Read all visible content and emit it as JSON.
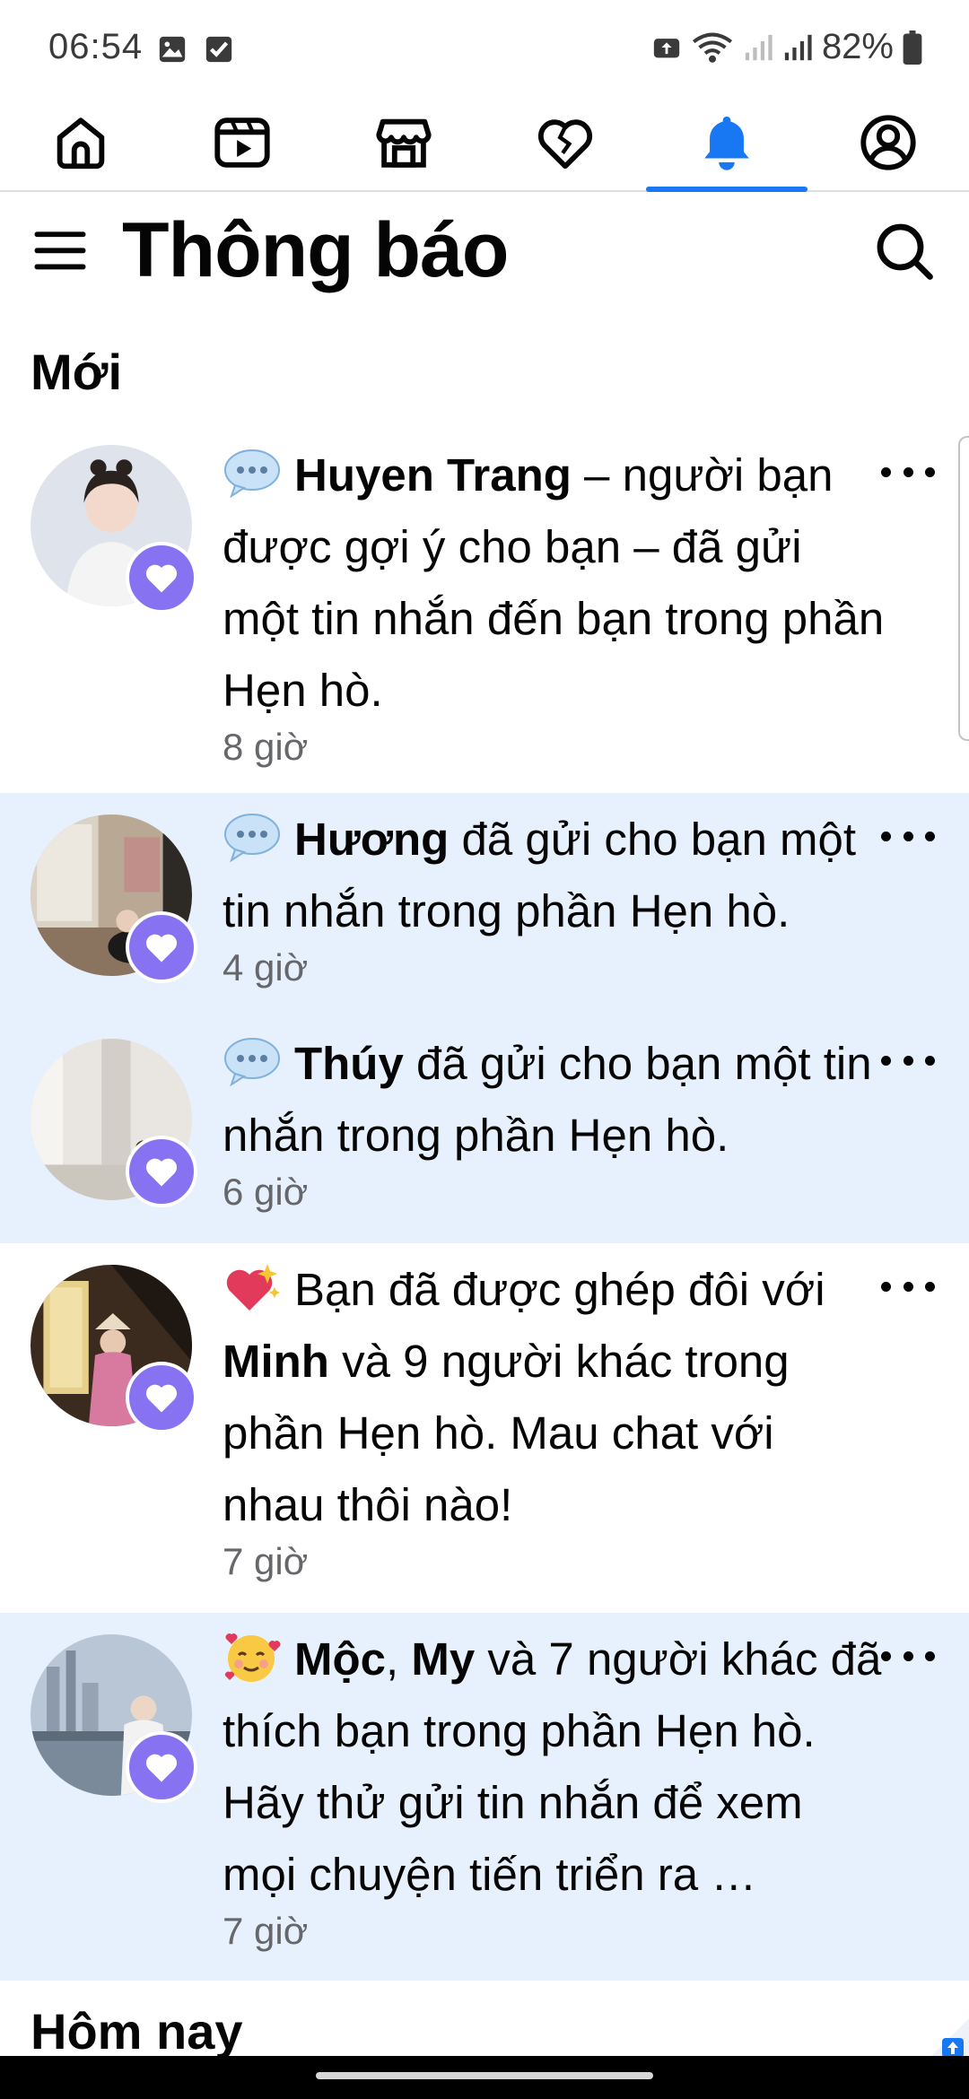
{
  "status_bar": {
    "time": "06:54",
    "battery": "82%",
    "left_icons": [
      "gallery-icon",
      "checkbox-icon"
    ],
    "right_icons": [
      "upload-icon",
      "wifi-icon",
      "signal-icon",
      "battery-icon"
    ]
  },
  "tabs": [
    {
      "name": "home",
      "icon": "home-icon",
      "active": false
    },
    {
      "name": "watch",
      "icon": "video-icon",
      "active": false
    },
    {
      "name": "marketplace",
      "icon": "store-icon",
      "active": false
    },
    {
      "name": "dating",
      "icon": "heart-icon",
      "active": false
    },
    {
      "name": "notifications",
      "icon": "bell-icon",
      "active": true
    },
    {
      "name": "profile",
      "icon": "profile-icon",
      "active": false
    }
  ],
  "header": {
    "title": "Thông báo"
  },
  "sections": {
    "new": "Mới",
    "today": "Hôm nay"
  },
  "colors": {
    "accent": "#1877f2",
    "unread_bg": "#e7f0fd",
    "dating_badge": "#8773f1"
  },
  "notifications": [
    {
      "emoji": "speech-bubble-icon",
      "name": "Huyen Trang",
      "text": " – người bạn được gợi ý cho bạn – đã gửi một tin nhắn đến bạn trong phần Hẹn hò.",
      "time": "8 giờ",
      "unread": false
    },
    {
      "emoji": "speech-bubble-icon",
      "name": "Hương",
      "text": " đã gửi cho bạn một tin nhắn trong phần Hẹn hò.",
      "time": "4 giờ",
      "unread": true
    },
    {
      "emoji": "speech-bubble-icon",
      "name": "Thúy",
      "text": " đã gửi cho bạn một tin nhắn trong phần Hẹn hò.",
      "time": "6 giờ",
      "unread": true
    },
    {
      "emoji": "sparkling-heart-icon",
      "text_before": "Bạn đã được ghép đôi với ",
      "name": "Minh",
      "text": " và 9 người khác trong phần Hẹn hò. Mau chat với nhau thôi nào!",
      "time": "7 giờ",
      "unread": false
    },
    {
      "emoji": "smiling-face-hearts-icon",
      "name": "Mộc",
      "separator": ", ",
      "name2": "My",
      "text": " và 7 người khác đã thích bạn trong phần Hẹn hò. Hãy thử gửi tin nhắn để xem mọi chuyện tiến triển ra …",
      "time": "7 giờ",
      "unread": true
    }
  ]
}
